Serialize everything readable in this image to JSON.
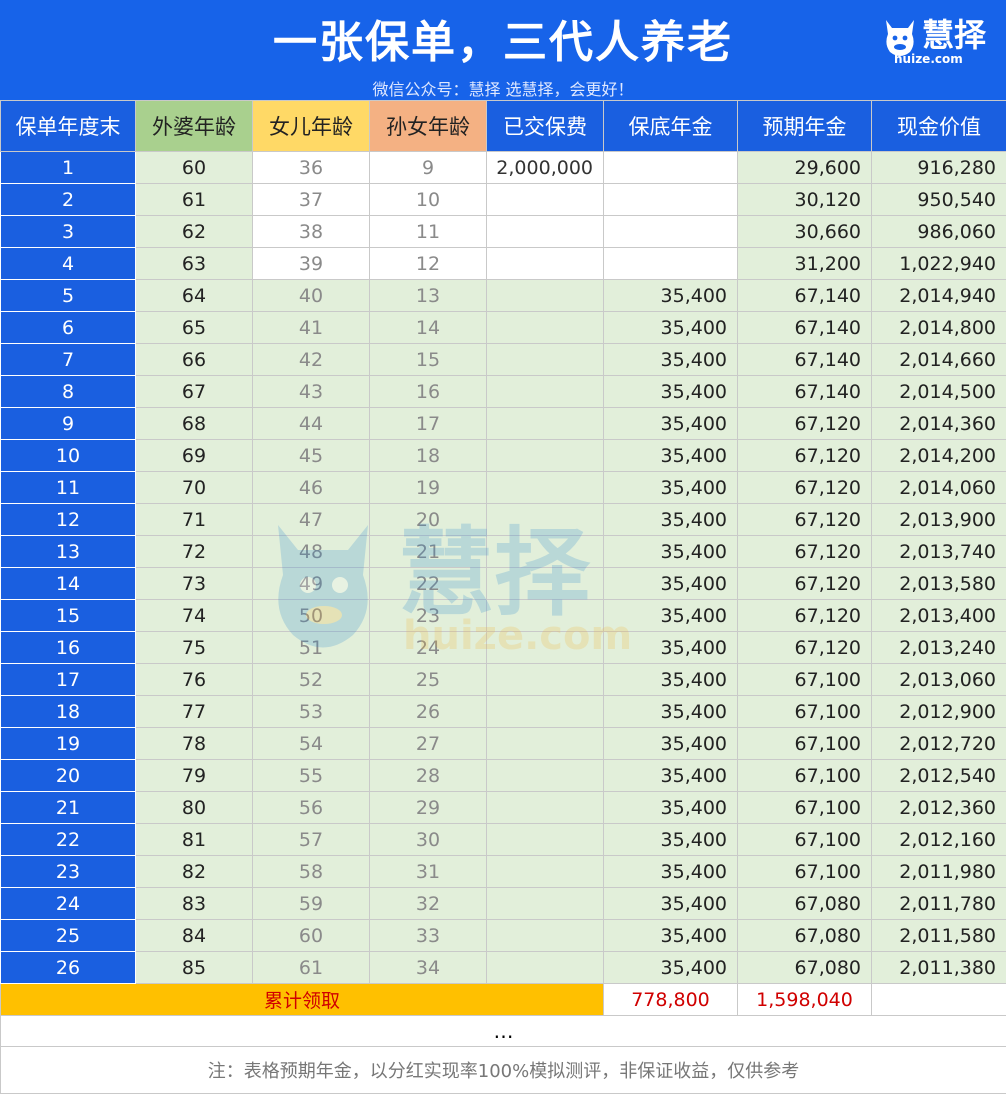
{
  "header": {
    "title": "一张保单，三代人养老",
    "subtitle": "微信公众号：慧择  选慧择，会更好！",
    "logo_text": "慧择",
    "logo_url": "huize.com"
  },
  "watermark": {
    "text": "慧择",
    "url": "huize.com"
  },
  "table": {
    "columns": [
      "保单年度末",
      "外婆年龄",
      "女儿年龄",
      "孙女年龄",
      "已交保费",
      "保底年金",
      "预期年金",
      "现金价值"
    ],
    "rows": [
      [
        "1",
        "60",
        "36",
        "9",
        "2,000,000",
        "",
        "29,600",
        "916,280"
      ],
      [
        "2",
        "61",
        "37",
        "10",
        "",
        "",
        "30,120",
        "950,540"
      ],
      [
        "3",
        "62",
        "38",
        "11",
        "",
        "",
        "30,660",
        "986,060"
      ],
      [
        "4",
        "63",
        "39",
        "12",
        "",
        "",
        "31,200",
        "1,022,940"
      ],
      [
        "5",
        "64",
        "40",
        "13",
        "",
        "35,400",
        "67,140",
        "2,014,940"
      ],
      [
        "6",
        "65",
        "41",
        "14",
        "",
        "35,400",
        "67,140",
        "2,014,800"
      ],
      [
        "7",
        "66",
        "42",
        "15",
        "",
        "35,400",
        "67,140",
        "2,014,660"
      ],
      [
        "8",
        "67",
        "43",
        "16",
        "",
        "35,400",
        "67,140",
        "2,014,500"
      ],
      [
        "9",
        "68",
        "44",
        "17",
        "",
        "35,400",
        "67,120",
        "2,014,360"
      ],
      [
        "10",
        "69",
        "45",
        "18",
        "",
        "35,400",
        "67,120",
        "2,014,200"
      ],
      [
        "11",
        "70",
        "46",
        "19",
        "",
        "35,400",
        "67,120",
        "2,014,060"
      ],
      [
        "12",
        "71",
        "47",
        "20",
        "",
        "35,400",
        "67,120",
        "2,013,900"
      ],
      [
        "13",
        "72",
        "48",
        "21",
        "",
        "35,400",
        "67,120",
        "2,013,740"
      ],
      [
        "14",
        "73",
        "49",
        "22",
        "",
        "35,400",
        "67,120",
        "2,013,580"
      ],
      [
        "15",
        "74",
        "50",
        "23",
        "",
        "35,400",
        "67,120",
        "2,013,400"
      ],
      [
        "16",
        "75",
        "51",
        "24",
        "",
        "35,400",
        "67,120",
        "2,013,240"
      ],
      [
        "17",
        "76",
        "52",
        "25",
        "",
        "35,400",
        "67,100",
        "2,013,060"
      ],
      [
        "18",
        "77",
        "53",
        "26",
        "",
        "35,400",
        "67,100",
        "2,012,900"
      ],
      [
        "19",
        "78",
        "54",
        "27",
        "",
        "35,400",
        "67,100",
        "2,012,720"
      ],
      [
        "20",
        "79",
        "55",
        "28",
        "",
        "35,400",
        "67,100",
        "2,012,540"
      ],
      [
        "21",
        "80",
        "56",
        "29",
        "",
        "35,400",
        "67,100",
        "2,012,360"
      ],
      [
        "22",
        "81",
        "57",
        "30",
        "",
        "35,400",
        "67,100",
        "2,012,160"
      ],
      [
        "23",
        "82",
        "58",
        "31",
        "",
        "35,400",
        "67,100",
        "2,011,980"
      ],
      [
        "24",
        "83",
        "59",
        "32",
        "",
        "35,400",
        "67,080",
        "2,011,780"
      ],
      [
        "25",
        "84",
        "60",
        "33",
        "",
        "35,400",
        "67,080",
        "2,011,580"
      ],
      [
        "26",
        "85",
        "61",
        "34",
        "",
        "35,400",
        "67,080",
        "2,011,380"
      ]
    ],
    "summary": {
      "label": "累计领取",
      "guaranteed_total": "778,800",
      "expected_total": "1,598,040"
    },
    "ellipsis": "…",
    "note": "注：表格预期年金，以分红实现率100%模拟测评，非保证收益，仅供参考"
  },
  "colors": {
    "header_blue": "#1763e9",
    "green_header": "#a9d08e",
    "yellow_header": "#ffd966",
    "orange_header": "#f4b183",
    "light_green_cell": "#e2efda",
    "summary_yellow": "#ffc000",
    "summary_text_red": "#d00000"
  }
}
